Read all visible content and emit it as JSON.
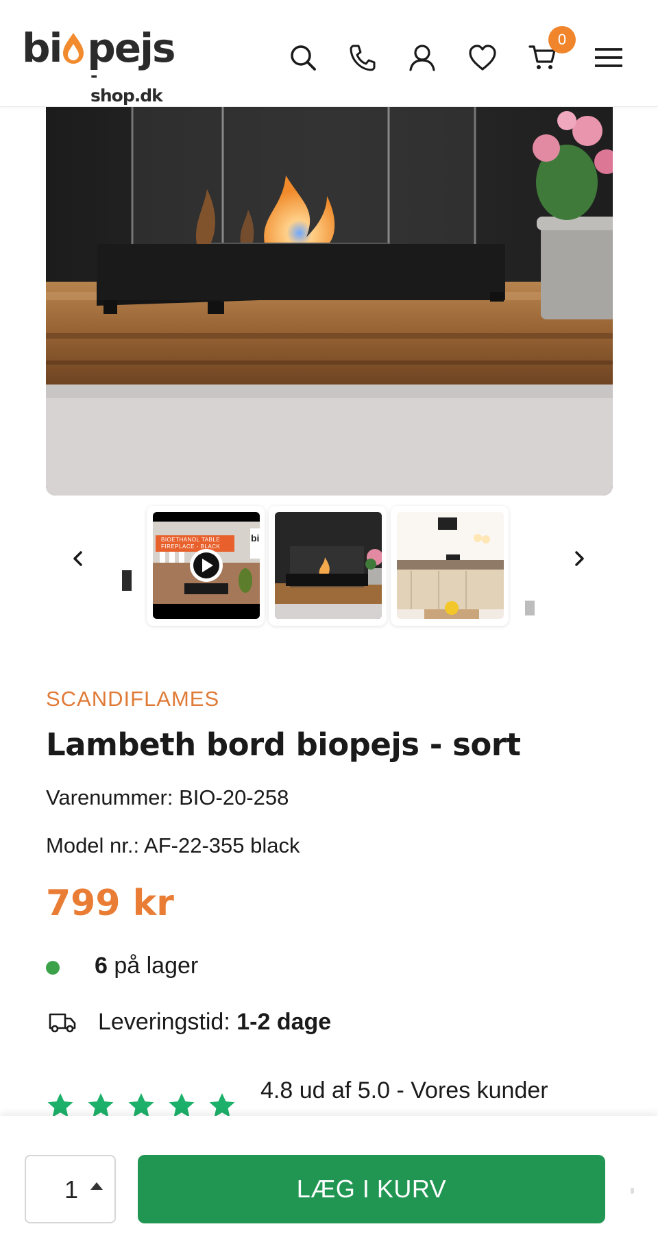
{
  "header": {
    "logo_main": "biopejs",
    "logo_sub": "-shop.dk",
    "icons": [
      "search-icon",
      "phone-icon",
      "user-icon",
      "heart-icon",
      "cart-icon",
      "menu-icon"
    ],
    "cart_count": "0"
  },
  "colors": {
    "accent_orange": "#e97d35",
    "brand_orange": "#e07b37",
    "cta_green": "#219653",
    "star_green": "#1db06a",
    "stock_green": "#3ca24a"
  },
  "gallery": {
    "thumbnails": [
      {
        "type": "video",
        "overlay_line1": "BIOETHANOL TABLE",
        "overlay_line2": "FIREPLACE - BLACK",
        "corner_text": "bi"
      },
      {
        "type": "image"
      },
      {
        "type": "image"
      }
    ],
    "prev_icon": "chevron-left-icon",
    "next_icon": "chevron-right-icon"
  },
  "product": {
    "brand": "SCANDIFLAMES",
    "title": "Lambeth bord biopejs - sort",
    "sku_label": "Varenummer: BIO-20-258",
    "model_label": "Model nr.: AF-22-355 black",
    "price": "799 kr",
    "stock_count": "6",
    "stock_text": " på lager",
    "delivery_label": "Leveringstid: ",
    "delivery_value": "1-2 dage",
    "rating_text": "4.8 ud af 5.0 - Vores kunder",
    "rating_stars": 5
  },
  "cart_bar": {
    "quantity": "1",
    "add_button": "LÆG I KURV"
  }
}
